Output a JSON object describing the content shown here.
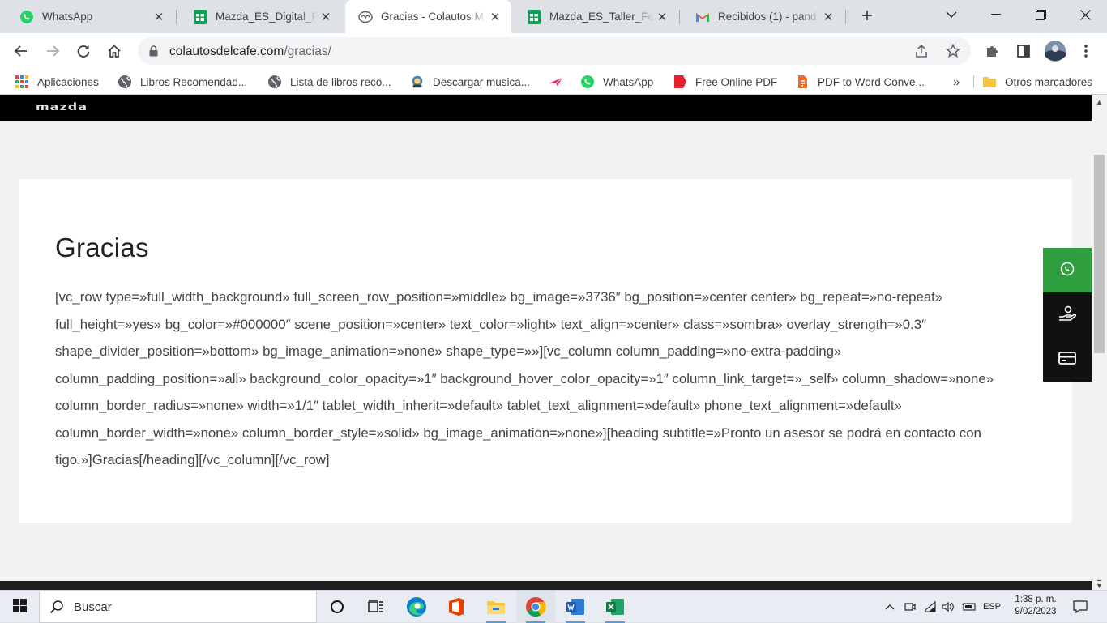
{
  "browser": {
    "tabs": [
      {
        "title": "WhatsApp",
        "icon": "whatsapp-icon",
        "active": false
      },
      {
        "title": "Mazda_ES_Digital_Fe",
        "icon": "sheets-icon",
        "active": false
      },
      {
        "title": "Gracias - Colautos M",
        "icon": "mazda-icon",
        "active": true
      },
      {
        "title": "Mazda_ES_Taller_Feb",
        "icon": "sheets-icon",
        "active": false
      },
      {
        "title": "Recibidos (1) - pand",
        "icon": "gmail-icon",
        "active": false
      }
    ],
    "url_domain": "colautosdelcafe.com",
    "url_path": "/gracias/",
    "bookmarks": [
      {
        "label": "Aplicaciones",
        "icon": "apps-grid-icon"
      },
      {
        "label": "Libros Recomendad...",
        "icon": "globe-icon"
      },
      {
        "label": "Lista de libros reco...",
        "icon": "globe-icon"
      },
      {
        "label": "Descargar musica...",
        "icon": "music-download-icon"
      },
      {
        "label": "",
        "icon": "paper-plane-icon"
      },
      {
        "label": "WhatsApp",
        "icon": "whatsapp-icon"
      },
      {
        "label": "Free Online PDF",
        "icon": "pdf-icon"
      },
      {
        "label": "PDF to Word Conve...",
        "icon": "pdf-convert-icon"
      }
    ],
    "bookmarks_overflow": "»",
    "other_bookmarks": "Otros marcadores"
  },
  "page": {
    "logo_text": "mazda",
    "heading": "Gracias",
    "body_text": "[vc_row type=»full_width_background» full_screen_row_position=»middle» bg_image=»3736″ bg_position=»center center» bg_repeat=»no-repeat» full_height=»yes» bg_color=»#000000″ scene_position=»center» text_color=»light» text_align=»center» class=»sombra» overlay_strength=»0.3″ shape_divider_position=»bottom» bg_image_animation=»none» shape_type=»»][vc_column column_padding=»no-extra-padding» column_padding_position=»all» background_color_opacity=»1″ background_hover_color_opacity=»1″ column_link_target=»_self» column_shadow=»none» column_border_radius=»none» width=»1/1″ tablet_width_inherit=»default» tablet_text_alignment=»default» phone_text_alignment=»default» column_border_width=»none» column_border_style=»solid» bg_image_animation=»none»][heading subtitle=»Pronto un asesor se podrá en contacto con tigo.»]Gracias[/heading][/vc_column][/vc_row]",
    "floating_buttons": [
      "whatsapp-icon",
      "hand-money-icon",
      "credit-card-icon"
    ]
  },
  "taskbar": {
    "search_placeholder": "Buscar",
    "apps": [
      "cortana-icon",
      "task-view-icon",
      "edge-icon",
      "office-icon",
      "file-explorer-icon",
      "chrome-icon",
      "word-icon",
      "excel-icon"
    ],
    "language": "ESP",
    "time": "1:38 p. m.",
    "date": "9/02/2023"
  },
  "colors": {
    "whatsapp_green": "#2e9e3f",
    "header_black": "#000000",
    "page_bg": "#f2f2f2"
  }
}
